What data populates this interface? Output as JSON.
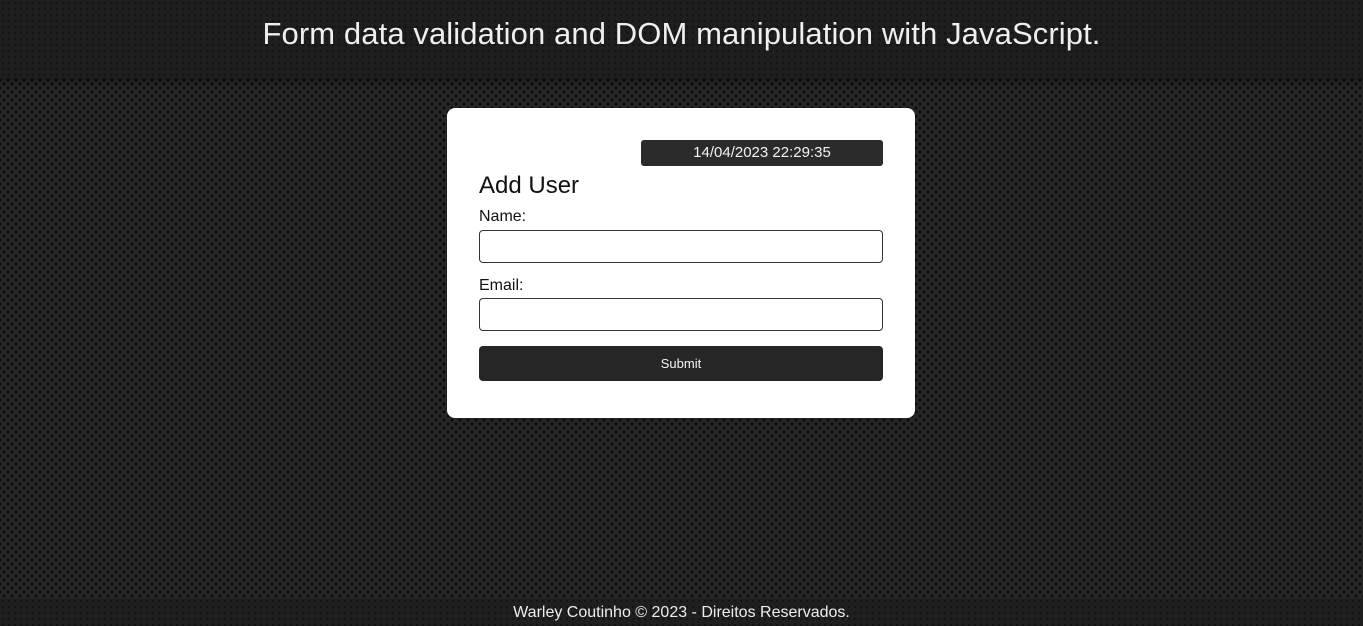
{
  "header": {
    "title": "Form data validation and DOM manipulation with JavaScript."
  },
  "form": {
    "datetime": "14/04/2023 22:29:35",
    "title": "Add User",
    "name_label": "Name:",
    "name_value": "",
    "email_label": "Email:",
    "email_value": "",
    "submit_label": "Submit"
  },
  "footer": {
    "text": "Warley Coutinho © 2023 - Direitos Reservados."
  },
  "colors": {
    "background": "#262626",
    "card": "#ffffff",
    "button": "#262626",
    "datetime_badge": "#2b2b2b"
  }
}
